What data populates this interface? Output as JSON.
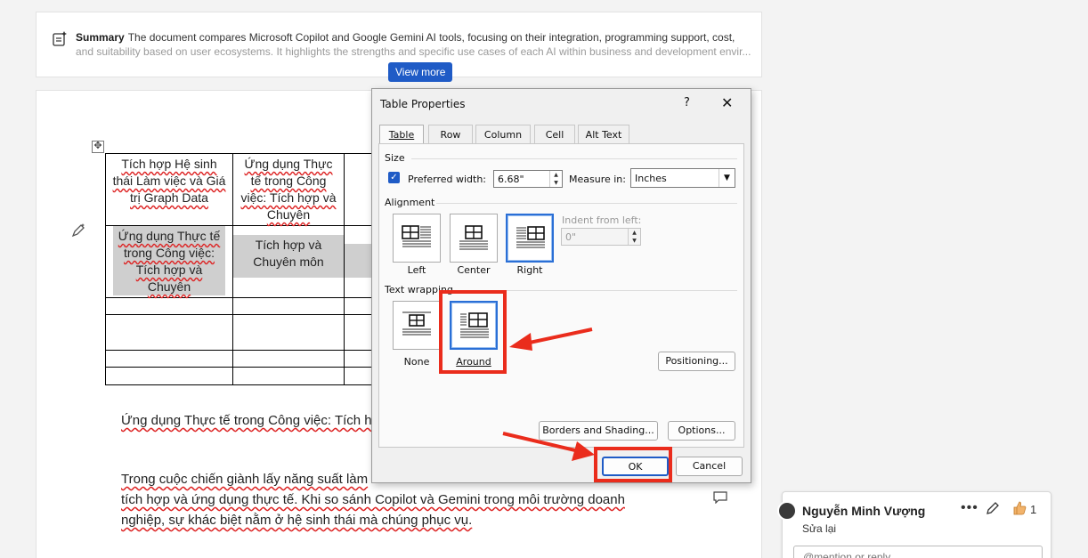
{
  "summary": {
    "label": "Summary",
    "line1": "The document compares Microsoft Copilot and Google Gemini AI tools, focusing on their integration, programming support, cost,",
    "line2": "and suitability based on user ecosystems. It highlights the strengths and specific use cases of each AI within business and development envir...",
    "view_more": "View more"
  },
  "document": {
    "table": {
      "row1": [
        "Tích hợp Hệ sinh thái Làm việc và Giá trị Graph Data",
        "Ứng dụng Thực tế trong Công việc: Tích hợp và Chuyên"
      ],
      "row2": [
        "Ứng dụng Thực tế trong Công việc: Tích hợp và Chuyên",
        "Tích hợp và Chuyên môn"
      ]
    },
    "para1": "Ứng dụng Thực tế trong Công việc: Tích hợ",
    "para2_line1": "Trong cuộc chiến giành lấy năng suất làm",
    "para2_line2": "tích hợp và ứng dụng thực tế. Khi so sánh Copilot và Gemini trong môi trường doanh",
    "para2_line3": "nghiệp, sự khác biệt nằm ở hệ sinh thái mà chúng phục vụ."
  },
  "comment": {
    "author": "Nguyễn Minh Vượng",
    "more": "•••",
    "likes": "1",
    "body": "Sửa lại",
    "reply_placeholder": "@mention or reply"
  },
  "dialog": {
    "title": "Table Properties",
    "help": "?",
    "close": "✕",
    "tabs": [
      "Table",
      "Row",
      "Column",
      "Cell",
      "Alt Text"
    ],
    "size": {
      "section": "Size",
      "preferred_width_label": "Preferred width:",
      "preferred_width_value": "6.68\"",
      "measure_label": "Measure in:",
      "measure_value": "Inches"
    },
    "alignment": {
      "section": "Alignment",
      "options": [
        "Left",
        "Center",
        "Right"
      ],
      "selected": "Right",
      "indent_label": "Indent from left:",
      "indent_value": "0\""
    },
    "wrapping": {
      "section": "Text wrapping",
      "options": [
        "None",
        "Around"
      ],
      "selected": "Around",
      "positioning": "Positioning..."
    },
    "borders_button": "Borders and Shading...",
    "options_button": "Options...",
    "ok": "OK",
    "cancel": "Cancel"
  },
  "colors": {
    "accent": "#1f5bc6",
    "annotation": "#ea2c1c"
  }
}
